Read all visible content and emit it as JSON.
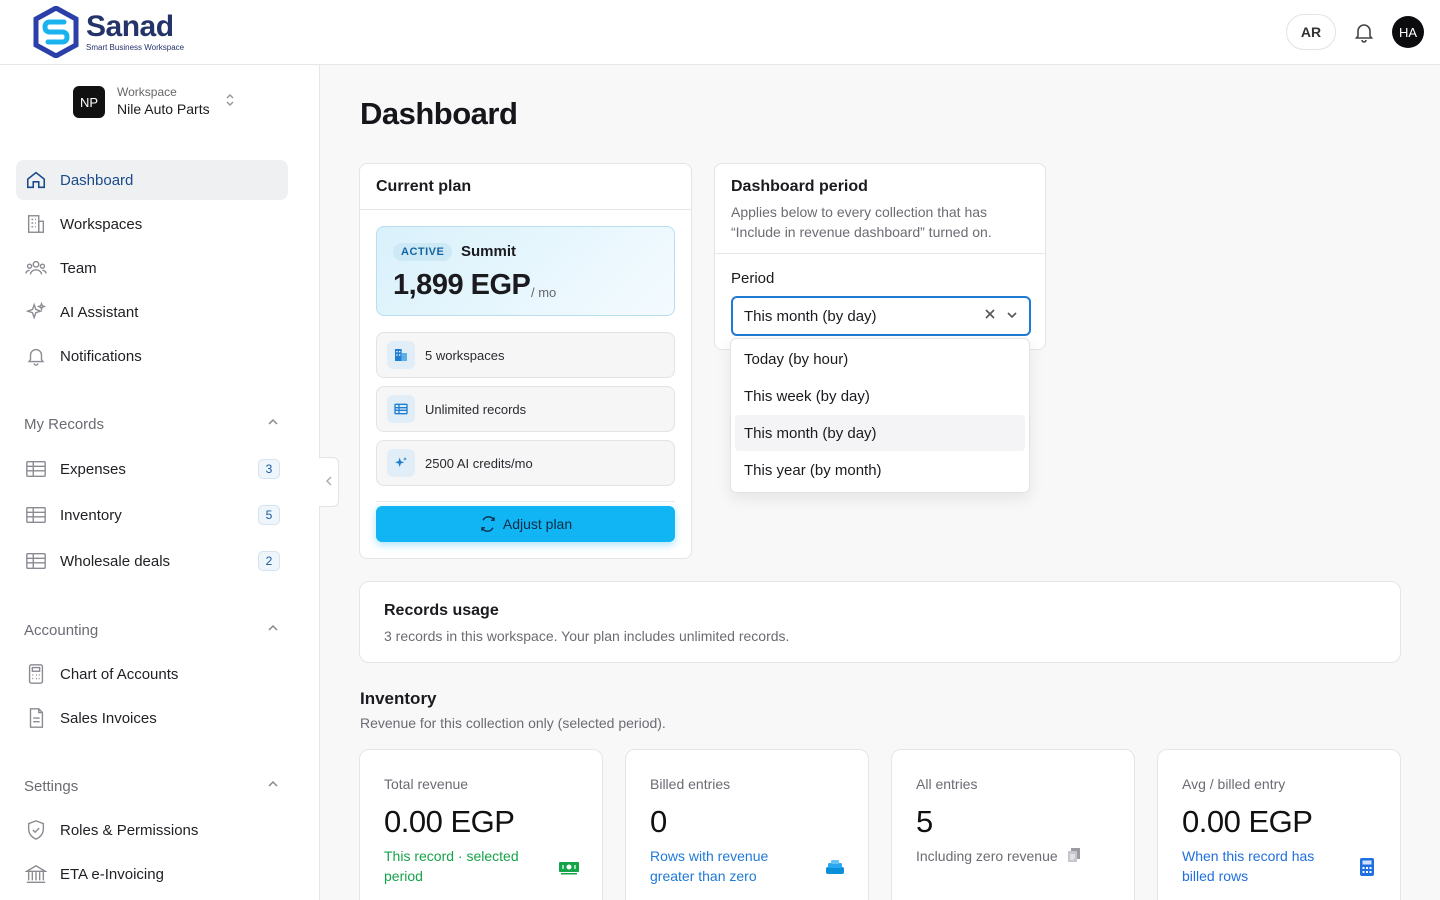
{
  "header": {
    "brand": "Sanad",
    "brand_tagline": "Smart Business Workspace",
    "lang_button": "AR",
    "user_initials": "HA"
  },
  "sidebar": {
    "workspace_label": "Workspace",
    "workspace_name": "Nile Auto Parts",
    "workspace_initials": "NP",
    "main_nav": [
      {
        "label": "Dashboard",
        "icon": "home-icon",
        "active": true
      },
      {
        "label": "Workspaces",
        "icon": "building-icon"
      },
      {
        "label": "Team",
        "icon": "team-icon"
      },
      {
        "label": "AI Assistant",
        "icon": "sparkles-icon"
      },
      {
        "label": "Notifications",
        "icon": "bell-icon"
      }
    ],
    "my_records": {
      "title": "My Records",
      "items": [
        {
          "label": "Expenses",
          "count": "3"
        },
        {
          "label": "Inventory",
          "count": "5"
        },
        {
          "label": "Wholesale deals",
          "count": "2"
        }
      ]
    },
    "accounting": {
      "title": "Accounting",
      "items": [
        {
          "label": "Chart of Accounts",
          "icon": "calculator-icon"
        },
        {
          "label": "Sales Invoices",
          "icon": "document-icon"
        }
      ]
    },
    "settings": {
      "title": "Settings",
      "items": [
        {
          "label": "Roles & Permissions",
          "icon": "shield-icon"
        },
        {
          "label": "ETA e-Invoicing",
          "icon": "bank-icon"
        }
      ]
    }
  },
  "main": {
    "title": "Dashboard",
    "plan": {
      "card_title": "Current plan",
      "status": "ACTIVE",
      "name": "Summit",
      "price": "1,899 EGP",
      "per": "/ mo",
      "features": [
        "5 workspaces",
        "Unlimited records",
        "2500 AI credits/mo"
      ],
      "adjust_label": "Adjust plan"
    },
    "period": {
      "card_title": "Dashboard period",
      "description_line1": "Applies below to every collection that has",
      "description_line2": "“Include in revenue dashboard” turned on.",
      "label": "Period",
      "selected": "This month (by day)",
      "options": [
        "Today (by hour)",
        "This week (by day)",
        "This month (by day)",
        "This year (by month)"
      ]
    },
    "usage": {
      "title": "Records usage",
      "description": "3 records in this workspace. Your plan includes unlimited records."
    },
    "inventory": {
      "title": "Inventory",
      "description": "Revenue for this collection only (selected period).",
      "stats": [
        {
          "label": "Total revenue",
          "value": "0.00 EGP",
          "foot_line1": "This record · selected",
          "foot_line2": "period",
          "color": "#16a34a"
        },
        {
          "label": "Billed entries",
          "value": "0",
          "foot_line1": "Rows with revenue",
          "foot_line2": "greater than zero",
          "color": "#1f7ad6"
        },
        {
          "label": "All entries",
          "value": "5",
          "foot_line1": "Including zero revenue",
          "foot_line2": "",
          "color": "#6b6b73"
        },
        {
          "label": "Avg / billed entry",
          "value": "0.00 EGP",
          "foot_line1": "When this record has",
          "foot_line2": "billed rows",
          "color": "#1f6fe0"
        }
      ]
    }
  }
}
